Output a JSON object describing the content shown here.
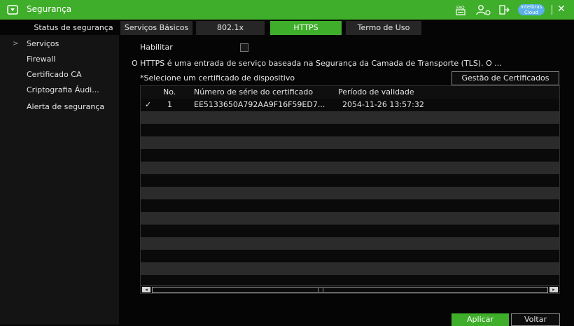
{
  "window": {
    "title": "Segurança",
    "icons": [
      "shield-icon",
      "faq-icon",
      "user-settings-icon",
      "logout-icon",
      "cloud-badge-icon",
      "close-icon"
    ],
    "cloud_badge": "Intelbras Cloud",
    "close_symbol": "✕",
    "accent": "#3fae2a"
  },
  "tabs": [
    {
      "label": "Status de segurança",
      "active": false
    },
    {
      "label": "Serviços Básicos",
      "active": false
    },
    {
      "label": "802.1x",
      "active": false
    },
    {
      "label": "HTTPS",
      "active": true
    },
    {
      "label": "Termo de Uso",
      "active": false
    }
  ],
  "sidebar": {
    "items": [
      {
        "label": "Serviços",
        "selected": true,
        "arrow": ">"
      },
      {
        "label": "Firewall"
      },
      {
        "label": "Certificado CA"
      },
      {
        "label": "Criptografia Áudi..."
      },
      {
        "label": "Alerta de segurança"
      }
    ]
  },
  "https": {
    "enable_label": "Habilitar",
    "enabled": false,
    "description": "O HTTPS é uma entrada de serviço baseada na Segurança da Camada de Transporte (TLS). O ...",
    "select_cert_label": "*Selecione um certificado de dispositivo",
    "manage_button": "Gestão de Certificados"
  },
  "cert_table": {
    "columns": [
      "No.",
      "Número de série do certificado",
      "Período de validade"
    ],
    "rows": [
      {
        "checked": true,
        "check": "✓",
        "no": "1",
        "serial": "EE5133650A792AA9F16F59ED7...",
        "validity": "2054-11-26 13:57:32"
      }
    ]
  },
  "scrollbar": {
    "left": "◂",
    "right": "▸"
  },
  "footer": {
    "apply_button": "Aplicar",
    "back_button": "Voltar"
  }
}
